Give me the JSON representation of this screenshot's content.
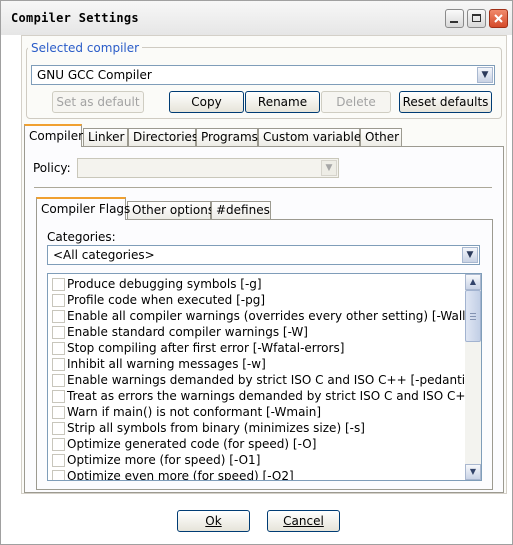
{
  "window": {
    "title": "Compiler Settings"
  },
  "selected_compiler": {
    "group_label": "Selected compiler",
    "value": "GNU GCC Compiler",
    "buttons": {
      "set_default": "Set as default",
      "copy": "Copy",
      "rename": "Rename",
      "delete": "Delete",
      "reset_defaults": "Reset defaults"
    }
  },
  "main_tabs": [
    "Compiler",
    "Linker",
    "Directories",
    "Programs",
    "Custom variables",
    "Other"
  ],
  "policy": {
    "label": "Policy:",
    "value": ""
  },
  "sub_tabs": [
    "Compiler Flags",
    "Other options",
    "#defines"
  ],
  "categories": {
    "label": "Categories:",
    "value": "<All categories>"
  },
  "flags": [
    "Produce debugging symbols  [-g]",
    "Profile code when executed  [-pg]",
    "Enable all compiler warnings (overrides every other setting)  [-Wall]",
    "Enable standard compiler warnings  [-W]",
    "Stop compiling after first error  [-Wfatal-errors]",
    "Inhibit all warning messages  [-w]",
    "Enable warnings demanded by strict ISO C and ISO C++  [-pedantic]",
    "Treat as errors the warnings demanded by strict ISO C and ISO C++  [-pedantic-errors]",
    "Warn if main() is not conformant  [-Wmain]",
    "Strip all symbols from binary (minimizes size)  [-s]",
    "Optimize generated code (for speed)  [-O]",
    "Optimize more (for speed)  [-O1]",
    "Optimize even more (for speed)  [-O2]"
  ],
  "dialog_buttons": {
    "ok": "Ok",
    "cancel": "Cancel"
  }
}
